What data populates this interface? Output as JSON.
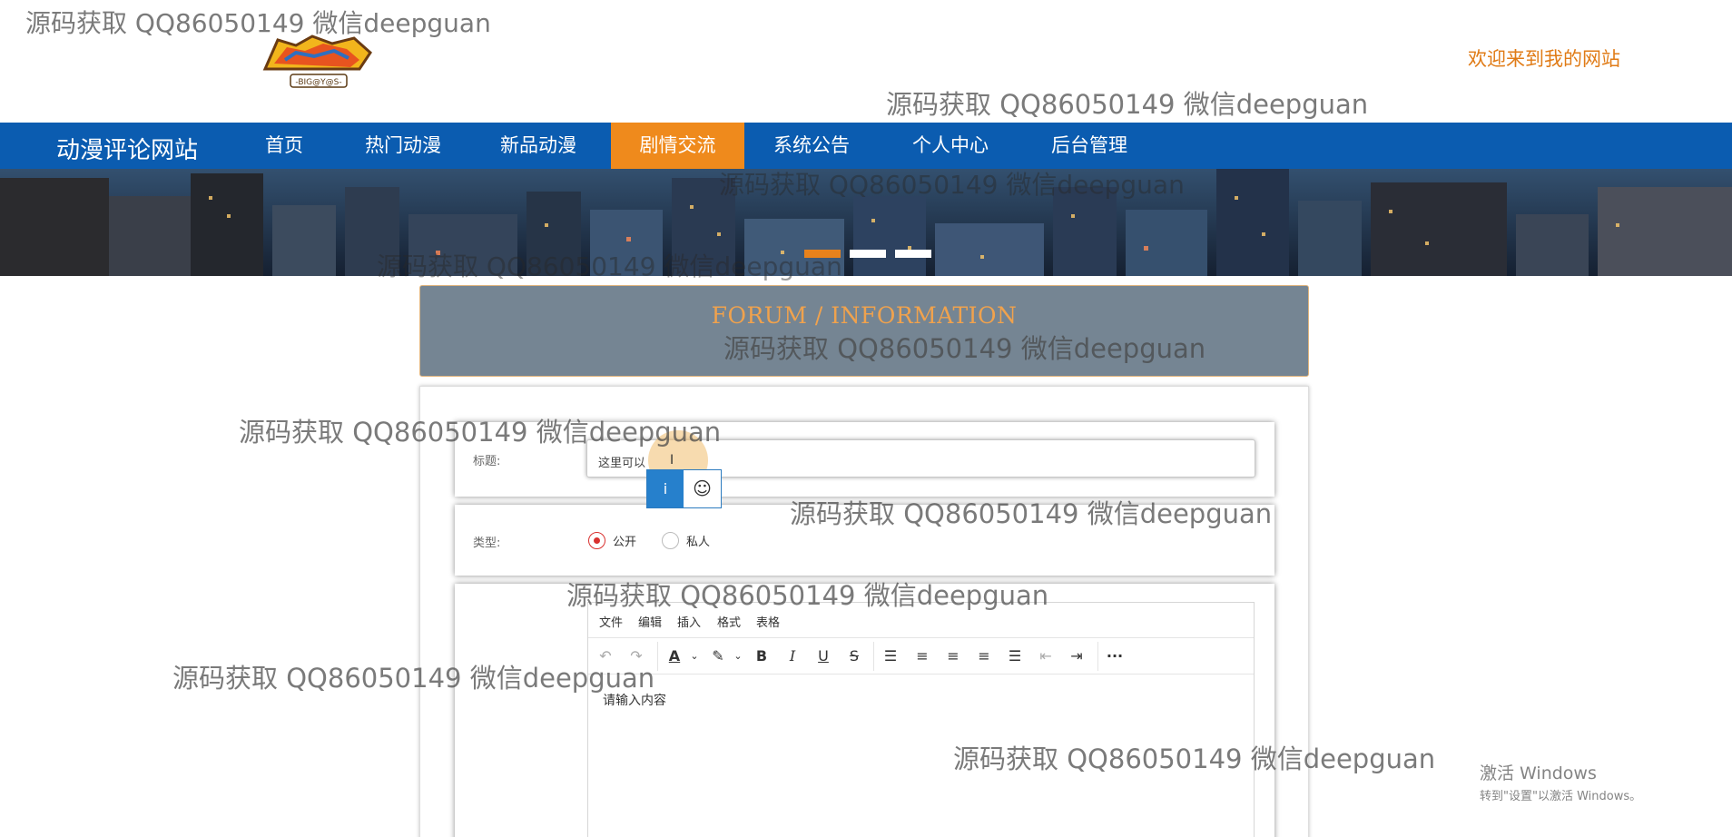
{
  "watermark_text": "源码获取 QQ86050149 微信deepguan",
  "header": {
    "logo_icon": "digimon-adventure-logo",
    "welcome": "欢迎来到我的网站"
  },
  "nav": {
    "brand": "动漫评论网站",
    "items": [
      {
        "label": "首页",
        "active": false
      },
      {
        "label": "热门动漫",
        "active": false
      },
      {
        "label": "新品动漫",
        "active": false
      },
      {
        "label": "剧情交流",
        "active": true
      },
      {
        "label": "系统公告",
        "active": false
      },
      {
        "label": "个人中心",
        "active": false
      },
      {
        "label": "后台管理",
        "active": false
      }
    ]
  },
  "banner": {
    "image": "night-city-skyline",
    "active_slide": 1,
    "slide_count": 3
  },
  "section": {
    "title_en": "FORUM / INFORMATION"
  },
  "form": {
    "title_label": "标题:",
    "title_value": "这里可以",
    "type_label": "类型:",
    "type_options": [
      {
        "label": "公开",
        "checked": true
      },
      {
        "label": "私人",
        "checked": false
      }
    ],
    "ime": {
      "left": "i",
      "right": "☺"
    }
  },
  "editor": {
    "menus": [
      "文件",
      "编辑",
      "插入",
      "格式",
      "表格"
    ],
    "toolbar_icons": [
      "undo-icon",
      "redo-icon",
      "font-color-icon",
      "highlight-icon",
      "bold-icon",
      "italic-icon",
      "underline-icon",
      "strikethrough-icon",
      "bullet-list-icon",
      "align-left-icon",
      "align-center-icon",
      "align-right-icon",
      "justify-icon",
      "outdent-icon",
      "indent-icon",
      "more-icon"
    ],
    "placeholder": "请输入内容"
  },
  "windows_activation": {
    "title": "激活 Windows",
    "subtitle": "转到\"设置\"以激活 Windows。"
  },
  "colors": {
    "nav_bg": "#0b5cb0",
    "nav_active": "#ef8a1c",
    "welcome": "#e07b16",
    "title_box": "#758593",
    "radio_checked": "#d9312f"
  }
}
